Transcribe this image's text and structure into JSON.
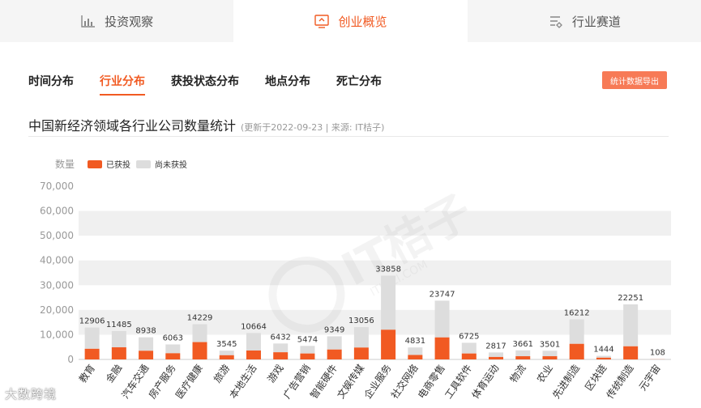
{
  "top_tabs": [
    {
      "label": "投资观察",
      "icon": "bar-chart-icon",
      "active": false
    },
    {
      "label": "创业概览",
      "icon": "startup-screen-icon",
      "active": true
    },
    {
      "label": "行业赛道",
      "icon": "filter-list-icon",
      "active": false
    }
  ],
  "sub_tabs": [
    {
      "label": "时间分布",
      "active": false
    },
    {
      "label": "行业分布",
      "active": true
    },
    {
      "label": "获投状态分布",
      "active": false
    },
    {
      "label": "地点分布",
      "active": false
    },
    {
      "label": "死亡分布",
      "active": false
    }
  ],
  "export_label": "统计数据导出",
  "title": "中国新经济领域各行业公司数量统计",
  "subtitle": "(更新于2022-09-23 | 来源: IT桔子)",
  "watermark": {
    "center": "IT桔子",
    "center_url": "ITJUZI.COM",
    "corner": "大数跨境"
  },
  "colors": {
    "funded": "#f15a22",
    "unfunded": "#dddddd",
    "accent": "#f15a22"
  },
  "chart_data": {
    "type": "bar",
    "stacked": true,
    "ylabel": "数量",
    "ylim": [
      0,
      70000
    ],
    "yticks": [
      "0",
      "10,000",
      "20,000",
      "30,000",
      "40,000",
      "50,000",
      "60,000",
      "70,000"
    ],
    "grid": "alternating bands",
    "legend_position": "top-left",
    "categories": [
      "教育",
      "金融",
      "汽车交通",
      "房产服务",
      "医疗健康",
      "旅游",
      "本地生活",
      "游戏",
      "广告营销",
      "智能硬件",
      "文娱传媒",
      "企业服务",
      "社交网络",
      "电商零售",
      "工具软件",
      "体育运动",
      "物流",
      "农业",
      "先进制造",
      "区块链",
      "传统制造",
      "元宇宙"
    ],
    "totals": [
      12906,
      11485,
      8938,
      6063,
      14229,
      3545,
      10664,
      6432,
      5474,
      9349,
      13056,
      33858,
      4831,
      23747,
      6725,
      2817,
      3661,
      3501,
      16212,
      1444,
      22251,
      108
    ],
    "series": [
      {
        "name": "已获投",
        "values": [
          4300,
          4900,
          3500,
          2500,
          7000,
          1700,
          3600,
          2900,
          2400,
          4000,
          4800,
          12000,
          1800,
          8900,
          2400,
          1000,
          1300,
          1300,
          6300,
          700,
          5300,
          50
        ]
      },
      {
        "name": "尚未获投",
        "values": [
          8606,
          6585,
          5438,
          3563,
          7229,
          1845,
          7064,
          3532,
          3074,
          5349,
          8256,
          21858,
          3031,
          14847,
          4325,
          1817,
          2361,
          2201,
          9912,
          744,
          16951,
          58
        ]
      }
    ]
  }
}
